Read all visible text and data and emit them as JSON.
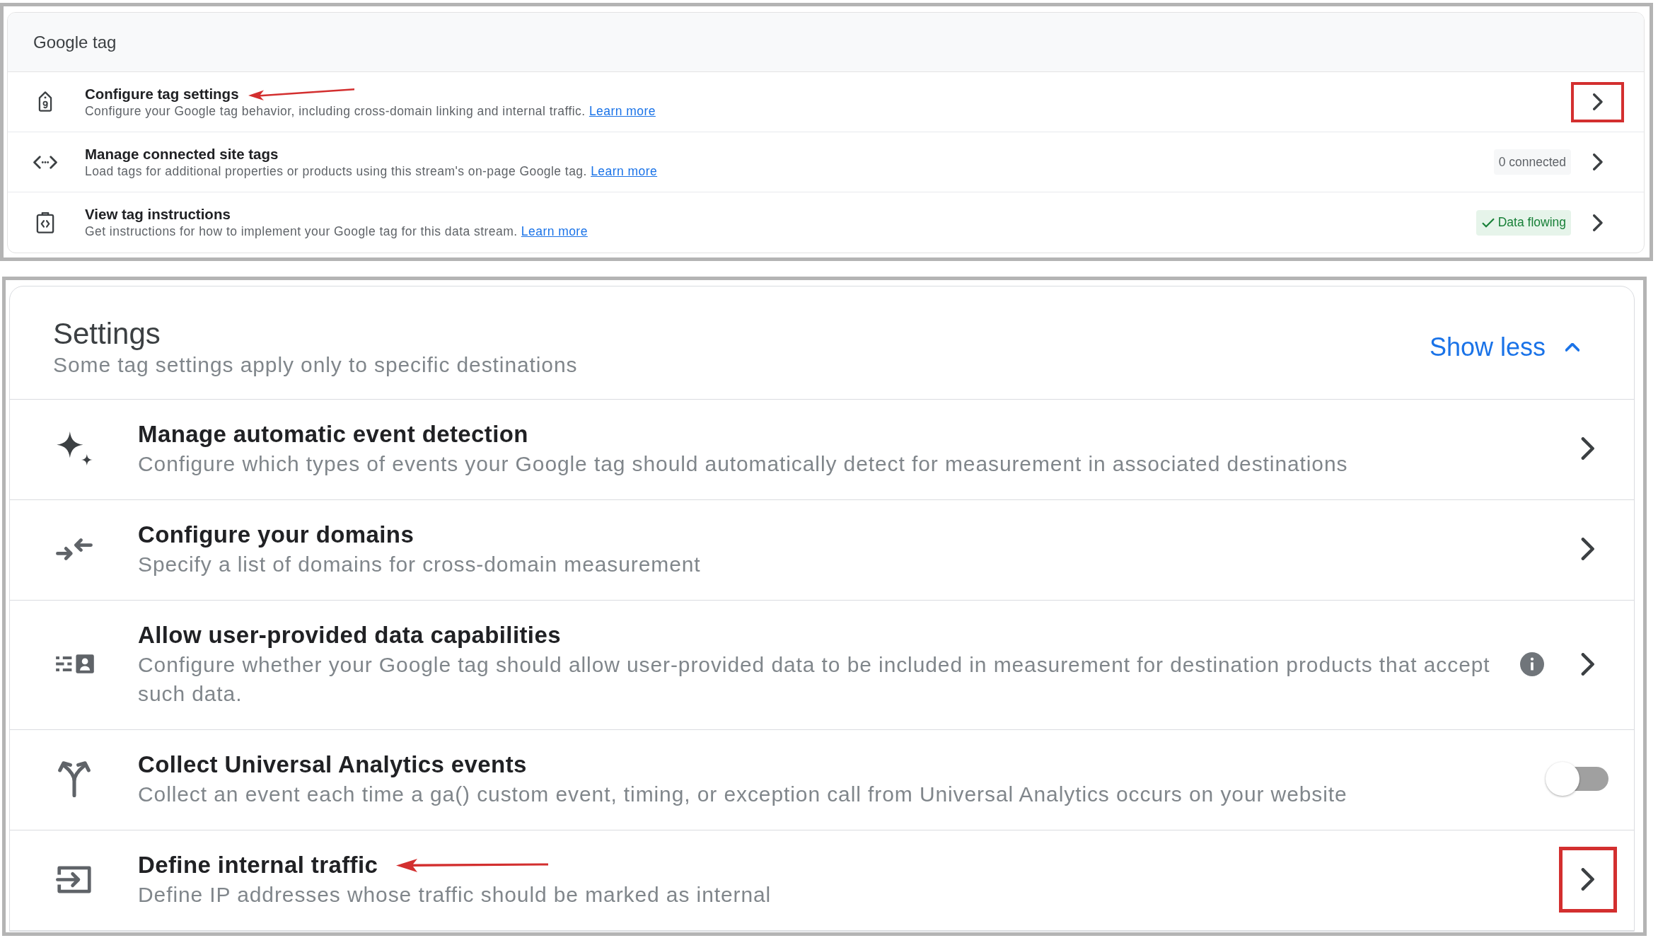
{
  "google_tag": {
    "title": "Google tag",
    "items": [
      {
        "title": "Configure tag settings",
        "description": "Configure your Google tag behavior, including cross-domain linking and internal traffic.",
        "link": "Learn more",
        "highlighted": true
      },
      {
        "title": "Manage connected site tags",
        "description": "Load tags for additional properties or products using this stream's on-page Google tag.",
        "link": "Learn more",
        "badge": {
          "kind": "neutral",
          "text": "0 connected"
        },
        "highlighted": false
      },
      {
        "title": "View tag instructions",
        "description": "Get instructions for how to implement your Google tag for this data stream.",
        "link": "Learn more",
        "badge": {
          "kind": "success",
          "text": "Data flowing"
        },
        "highlighted": false
      }
    ]
  },
  "settings": {
    "title": "Settings",
    "subtitle": "Some tag settings apply only to specific destinations",
    "toggle_link": "Show less",
    "expanded": true,
    "items": [
      {
        "kind": "link",
        "title": "Manage automatic event detection",
        "description": "Configure which types of events your Google tag should automatically detect for measurement in associated destinations",
        "info": false,
        "highlighted": false
      },
      {
        "kind": "link",
        "title": "Configure your domains",
        "description": "Specify a list of domains for cross-domain measurement",
        "info": false,
        "highlighted": false
      },
      {
        "kind": "link",
        "title": "Allow user-provided data capabilities",
        "description": "Configure whether your Google tag should allow user-provided data to be included in measurement for destination products that accept such data.",
        "info": true,
        "highlighted": false
      },
      {
        "kind": "toggle",
        "title": "Collect Universal Analytics events",
        "description": "Collect an event each time a ga() custom event, timing, or exception call from Universal Analytics occurs on your website",
        "info": false,
        "on": false,
        "highlighted": false
      },
      {
        "kind": "link",
        "title": "Define internal traffic",
        "description": "Define IP addresses whose traffic should be marked as internal",
        "info": false,
        "highlighted": true
      }
    ]
  }
}
